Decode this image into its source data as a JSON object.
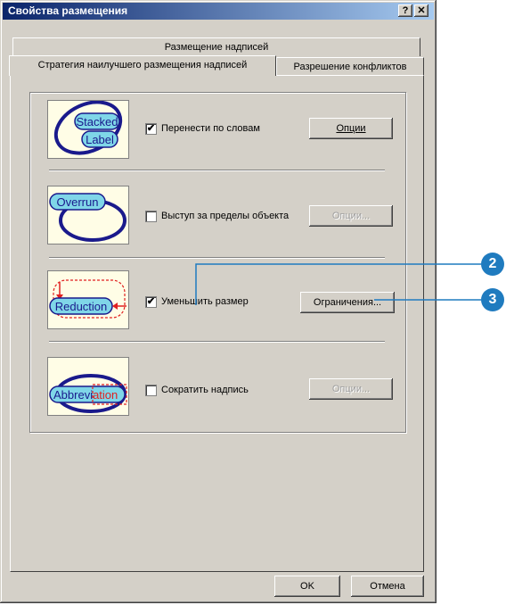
{
  "window": {
    "title": "Свойства размещения",
    "help_glyph": "?",
    "close_glyph": "✕"
  },
  "tabs": {
    "back": "Размещение надписей",
    "front_selected": "Стратегия наилучшего размещения надписей",
    "front_other": "Разрешение конфликтов"
  },
  "options": [
    {
      "icon_label": [
        "Stacked",
        "Label"
      ],
      "checked": true,
      "check_glyph": "✔",
      "label": "Перенести по словам",
      "button": "Опции",
      "button_enabled": true
    },
    {
      "icon_label": [
        "Overrun"
      ],
      "checked": false,
      "check_glyph": "",
      "label": "Выступ за пределы объекта",
      "button": "Опции...",
      "button_enabled": false
    },
    {
      "icon_label": [
        "Reduction"
      ],
      "checked": true,
      "check_glyph": "✔",
      "label": "Уменьшить размер",
      "button": "Ограничения...",
      "button_enabled": true
    },
    {
      "icon_label": [
        "Abbreviation"
      ],
      "icon_parts": [
        "Abbrevi",
        "ation"
      ],
      "checked": false,
      "check_glyph": "",
      "label": "Сократить надпись",
      "button": "Опции...",
      "button_enabled": false
    }
  ],
  "footer": {
    "ok": "OK",
    "cancel": "Отмена"
  },
  "callouts": [
    {
      "number": "2"
    },
    {
      "number": "3"
    }
  ],
  "colors": {
    "titlebar_start": "#0a246a",
    "titlebar_end": "#a6caf0",
    "callout": "#1f7bbf",
    "icon_ellipse": "#1a1a8c",
    "icon_pill": "#7fd6e8",
    "reduction_arrow": "#e02020"
  }
}
